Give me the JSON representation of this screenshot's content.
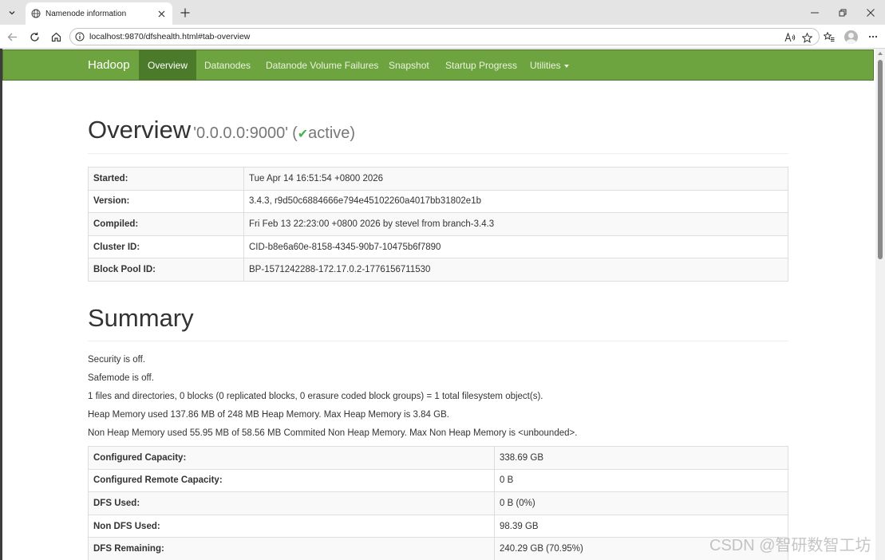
{
  "browser": {
    "tab_title": "Namenode information",
    "url": "localhost:9870/dfshealth.html#tab-overview"
  },
  "navbar": {
    "brand": "Hadoop",
    "items": [
      {
        "label": "Overview",
        "active": true
      },
      {
        "label": "Datanodes",
        "active": false
      },
      {
        "label": "Datanode Volume Failures",
        "active": false
      },
      {
        "label": "Snapshot",
        "active": false
      },
      {
        "label": "Startup Progress",
        "active": false
      },
      {
        "label": "Utilities",
        "active": false
      }
    ]
  },
  "overview": {
    "title": "Overview",
    "address": "'0.0.0.0:9000'",
    "state_open": "(",
    "state": "active",
    "state_close": ")",
    "rows": [
      {
        "key": "Started:",
        "value": "Tue Apr 14 16:51:54 +0800 2026"
      },
      {
        "key": "Version:",
        "value": "3.4.3, r9d50c6884666e794e45102260a4017bb31802e1b"
      },
      {
        "key": "Compiled:",
        "value": "Fri Feb 13 22:23:00 +0800 2026 by stevel from branch-3.4.3"
      },
      {
        "key": "Cluster ID:",
        "value": "CID-b8e6a60e-8158-4345-90b7-10475b6f7890"
      },
      {
        "key": "Block Pool ID:",
        "value": "BP-1571242288-172.17.0.2-1776156711530"
      }
    ]
  },
  "summary": {
    "title": "Summary",
    "lines": [
      "Security is off.",
      "Safemode is off.",
      "1 files and directories, 0 blocks (0 replicated blocks, 0 erasure coded block groups) = 1 total filesystem object(s).",
      "Heap Memory used 137.86 MB of 248 MB Heap Memory. Max Heap Memory is 3.84 GB.",
      "Non Heap Memory used 55.95 MB of 58.56 MB Commited Non Heap Memory. Max Non Heap Memory is <unbounded>."
    ],
    "rows": [
      {
        "key": "Configured Capacity:",
        "value": "338.69 GB"
      },
      {
        "key": "Configured Remote Capacity:",
        "value": "0 B"
      },
      {
        "key": "DFS Used:",
        "value": "0 B (0%)"
      },
      {
        "key": "Non DFS Used:",
        "value": "98.39 GB"
      },
      {
        "key": "DFS Remaining:",
        "value": "240.29 GB (70.95%)"
      }
    ]
  },
  "watermark": "CSDN @智研数智工坊",
  "colors": {
    "navbar": "#6ea43f",
    "navbar_active": "#4b7b2a",
    "check": "#4caf50"
  }
}
